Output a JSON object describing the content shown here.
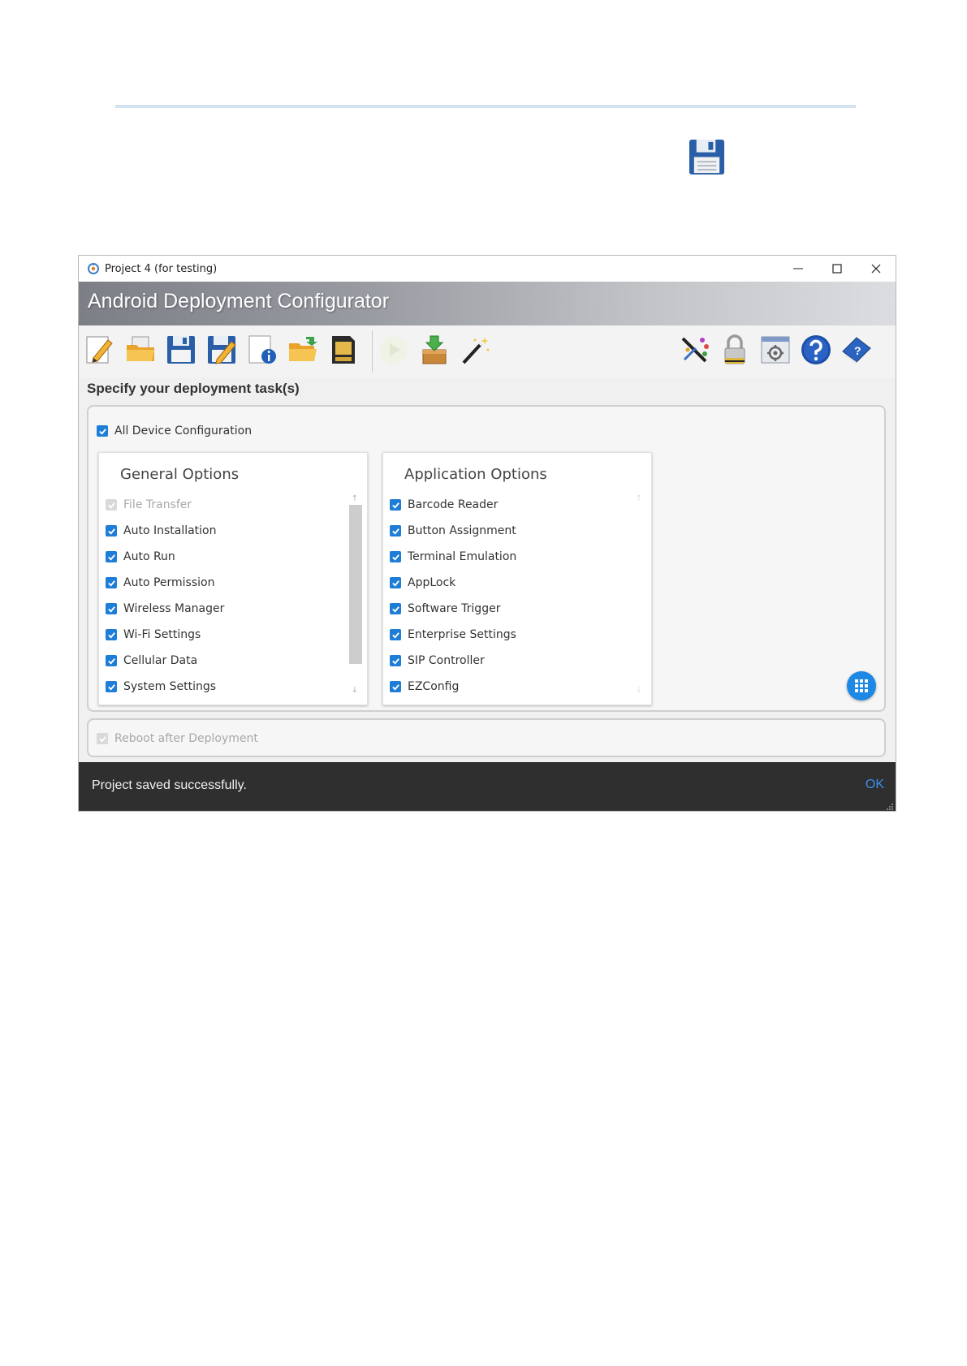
{
  "window": {
    "title": "Project 4 (for testing)",
    "banner_title": "Android Deployment Configurator"
  },
  "toolbar": {
    "left_buttons": [
      "new-project-icon",
      "open-project-icon",
      "save-icon",
      "save-as-icon",
      "project-info-icon",
      "open-folder-icon",
      "sd-card-icon",
      "run-icon",
      "deploy-package-icon",
      "wizard-icon"
    ],
    "right_buttons": [
      "customize-icon",
      "lock-icon",
      "settings-icon",
      "help-icon",
      "manual-icon"
    ]
  },
  "task_section": {
    "label": "Specify your deployment task(s)",
    "all_device_configuration": "All Device Configuration"
  },
  "general_options": {
    "title": "General Options",
    "items": [
      {
        "label": "File Transfer",
        "checked": true,
        "enabled": false
      },
      {
        "label": "Auto Installation",
        "checked": true,
        "enabled": true
      },
      {
        "label": "Auto Run",
        "checked": true,
        "enabled": true
      },
      {
        "label": "Auto Permission",
        "checked": true,
        "enabled": true
      },
      {
        "label": "Wireless Manager",
        "checked": true,
        "enabled": true
      },
      {
        "label": "Wi-Fi Settings",
        "checked": true,
        "enabled": true
      },
      {
        "label": "Cellular Data",
        "checked": true,
        "enabled": true
      },
      {
        "label": "System Settings",
        "checked": true,
        "enabled": true
      }
    ]
  },
  "application_options": {
    "title": "Application Options",
    "items": [
      {
        "label": "Barcode Reader",
        "checked": true,
        "enabled": true
      },
      {
        "label": "Button Assignment",
        "checked": true,
        "enabled": true
      },
      {
        "label": "Terminal Emulation",
        "checked": true,
        "enabled": true
      },
      {
        "label": "AppLock",
        "checked": true,
        "enabled": true
      },
      {
        "label": "Software Trigger",
        "checked": true,
        "enabled": true
      },
      {
        "label": "Enterprise Settings",
        "checked": true,
        "enabled": true
      },
      {
        "label": "SIP Controller",
        "checked": true,
        "enabled": true
      },
      {
        "label": "EZConfig",
        "checked": true,
        "enabled": true
      }
    ]
  },
  "reboot": {
    "label": "Reboot after Deployment",
    "checked": true,
    "enabled": false
  },
  "snackbar": {
    "message": "Project saved successfully.",
    "action": "OK"
  },
  "colors": {
    "accent": "#1e7dd6",
    "snackbar_bg": "#2f2f2f",
    "ok_text": "#3b8ff0"
  }
}
